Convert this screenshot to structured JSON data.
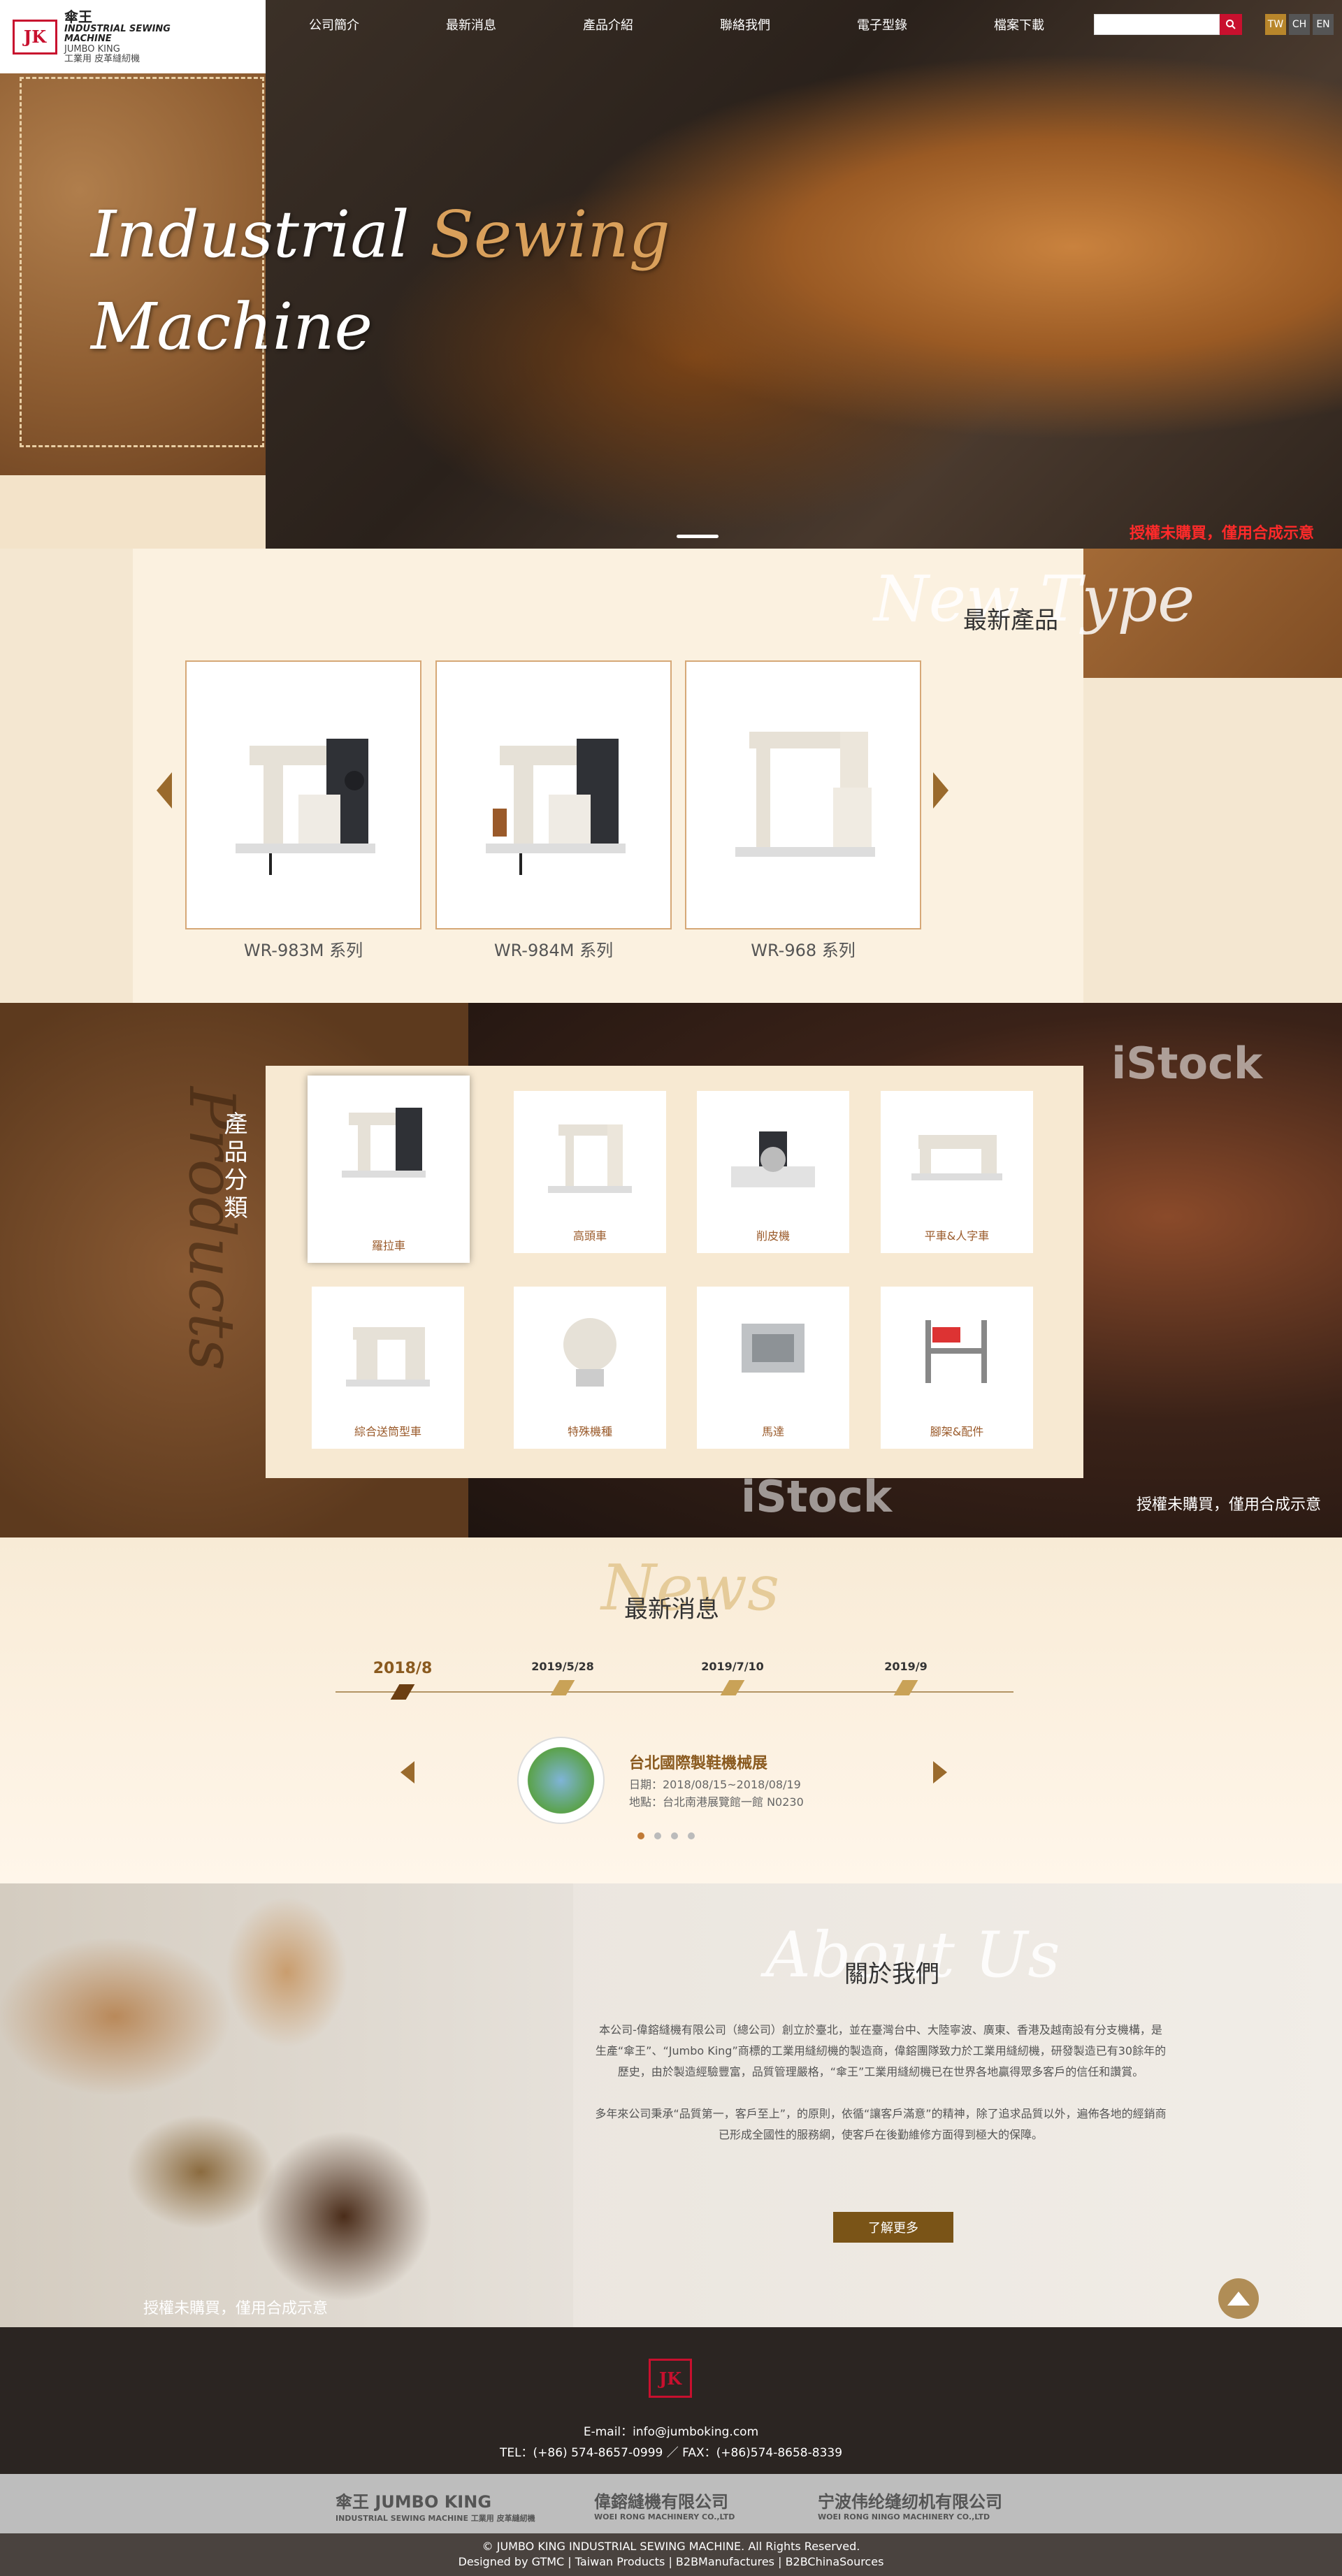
{
  "header": {
    "logo": {
      "mark": "JK",
      "cn": "傘王",
      "en_line1": "INDUSTRIAL SEWING",
      "en_line2": "MACHINE",
      "brand": "JUMBO KING",
      "sub": "工業用 皮革縫紉機"
    },
    "nav": [
      "公司簡介",
      "最新消息",
      "產品介紹",
      "聯絡我們",
      "電子型錄",
      "檔案下載"
    ],
    "search_placeholder": "",
    "search_icon": "search-icon",
    "languages": [
      "TW",
      "CH",
      "EN"
    ],
    "active_language": "TW"
  },
  "hero": {
    "title_word1": "Industrial",
    "title_word2": "Sewing",
    "title_word3": "Machine",
    "disclaimer": "授權未購買，僅用合成示意",
    "accent_color": "#d9a05b"
  },
  "new_products": {
    "bg_title": "New Type",
    "title": "最新產品",
    "items": [
      {
        "name": "WR-983M 系列"
      },
      {
        "name": "WR-984M 系列"
      },
      {
        "name": "WR-968 系列"
      }
    ]
  },
  "categories": {
    "bg_title": "Products",
    "title": "產品分類",
    "items": [
      {
        "label": "羅拉車"
      },
      {
        "label": "高頭車"
      },
      {
        "label": "削皮機"
      },
      {
        "label": "平車&人字車"
      },
      {
        "label": "綜合送筒型車"
      },
      {
        "label": "特殊機種"
      },
      {
        "label": "馬達"
      },
      {
        "label": "腳架&配件"
      }
    ],
    "active_index": 0,
    "watermark": "iStock",
    "disclaimer": "授權未購買，僅用合成示意"
  },
  "news": {
    "bg_title": "News",
    "title": "最新消息",
    "timeline": [
      "2018/8",
      "2019/5/28",
      "2019/7/10",
      "2019/9"
    ],
    "active_index": 0,
    "item": {
      "title": "台北國際製鞋機械展",
      "date": "日期：2018/08/15~2018/08/19",
      "place": "地點：台北南港展覽館一館 N0230"
    },
    "dots": 4
  },
  "about": {
    "bg_title": "About Us",
    "title": "關於我們",
    "para1": "本公司-偉鎔縫機有限公司（總公司）創立於臺北，並在臺灣台中、大陸寧波、廣東、香港及越南設有分支機構，是生產“傘王”、“Jumbo King”商標的工業用縫紉機的製造商，偉鎔團隊致力於工業用縫紉機，研發製造已有30餘年的歷史，由於製造經驗豐富，品質管理嚴格，“傘王”工業用縫紉機已在世界各地贏得眾多客戶的信任和讚賞。",
    "para2": "多年來公司秉承“品質第一，客戶至上”，的原則，依循“讓客戶滿意”的精神，除了追求品質以外，遍佈各地的經銷商已形成全國性的服務網，使客戶在後勤維修方面得到極大的保障。",
    "button": "了解更多",
    "disclaimer": "授權未購買，僅用合成示意"
  },
  "footer": {
    "email": "E-mail：info@jumboking.com",
    "tel": "TEL：(+86) 574-8657-0999 ／ FAX：(+86)574-8658-8339",
    "partners": [
      {
        "cn": "傘王 JUMBO KING",
        "en": "INDUSTRIAL SEWING MACHINE 工業用 皮革縫紉機"
      },
      {
        "cn": "偉鎔縫機有限公司",
        "en": "WOEI RONG MACHINERY CO.,LTD"
      },
      {
        "cn": "宁波伟纶缝纫机有限公司",
        "en": "WOEI RONG NINGO MACHINERY CO.,LTD"
      }
    ],
    "copyright": "© JUMBO KING INDUSTRIAL SEWING MACHINE. All Rights Reserved.",
    "designed": "Designed by GTMC",
    "links": [
      "Taiwan Products",
      "B2BManufactures",
      "B2BChinaSources"
    ]
  }
}
